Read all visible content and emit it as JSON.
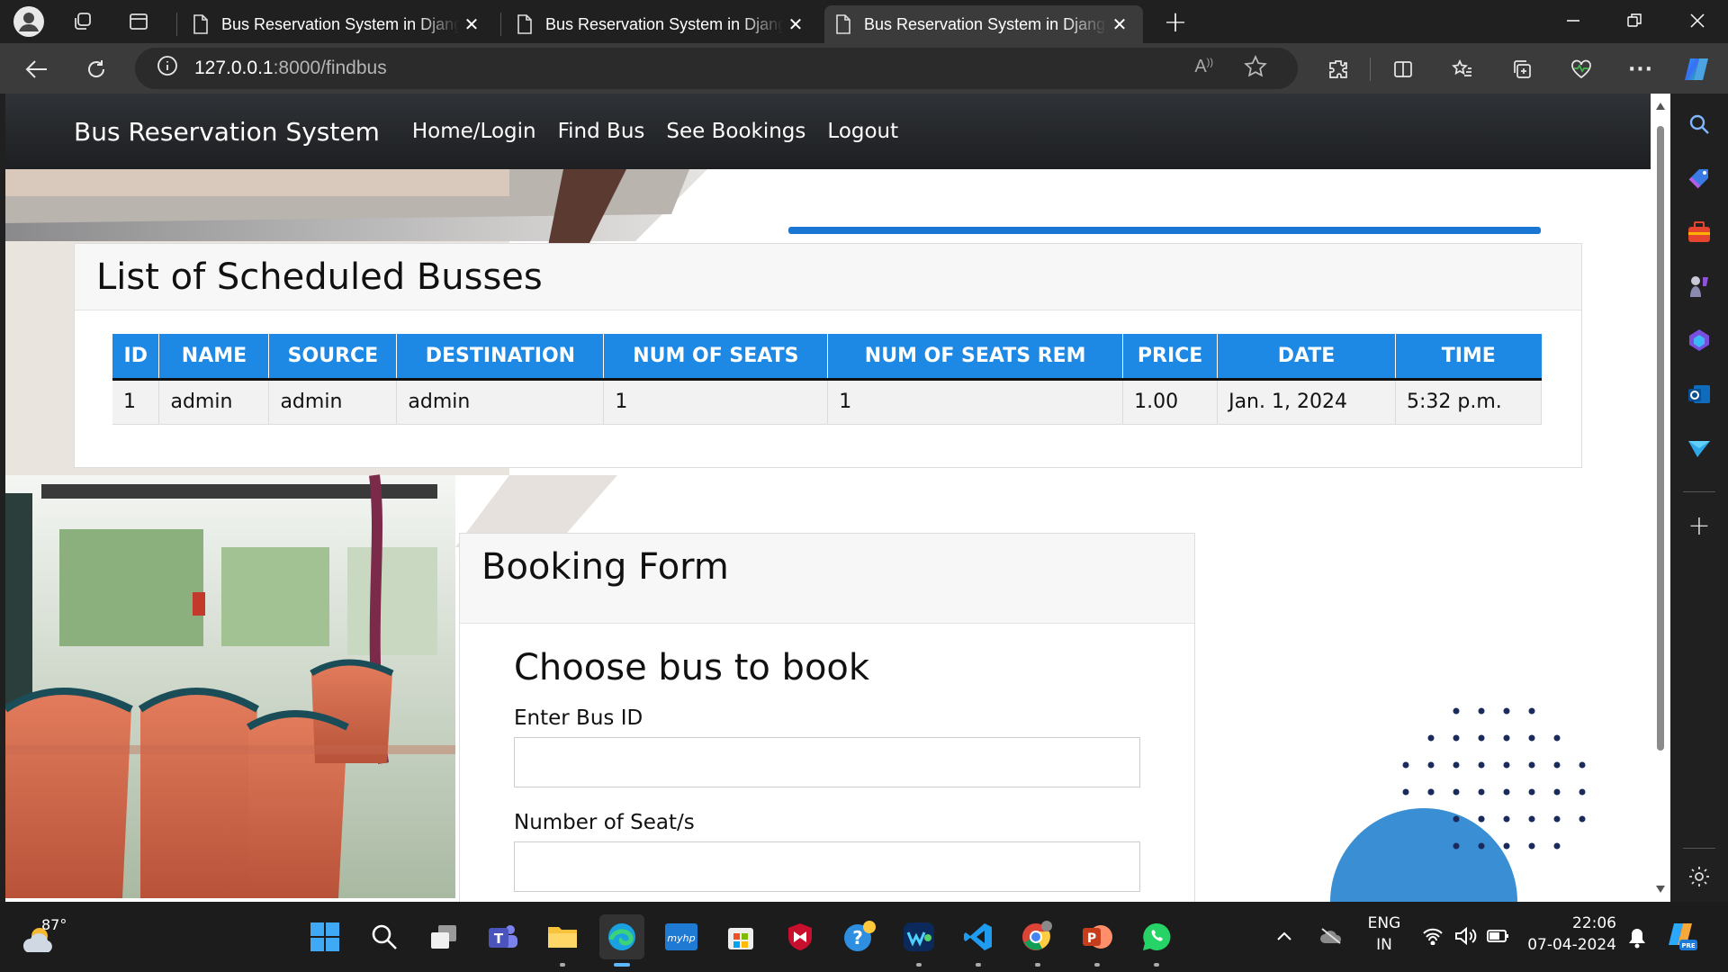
{
  "browser": {
    "tabs": [
      {
        "title": "Bus Reservation System in Django",
        "active": false
      },
      {
        "title": "Bus Reservation System in Django",
        "active": false
      },
      {
        "title": "Bus Reservation System in Django",
        "active": true
      }
    ],
    "url_host": "127.0.0.1",
    "url_path": ":8000/findbus"
  },
  "page": {
    "brand": "Bus Reservation System",
    "nav": [
      {
        "label": "Home/Login"
      },
      {
        "label": "Find Bus"
      },
      {
        "label": "See Bookings"
      },
      {
        "label": "Logout"
      }
    ],
    "bus_list": {
      "heading": "List of Scheduled Busses",
      "columns": [
        "ID",
        "NAME",
        "SOURCE",
        "DESTINATION",
        "NUM OF SEATS",
        "NUM OF SEATS REM",
        "PRICE",
        "DATE",
        "TIME"
      ],
      "rows": [
        [
          "1",
          "admin",
          "admin",
          "admin",
          "1",
          "1",
          "1.00",
          "Jan. 1, 2024",
          "5:32 p.m."
        ]
      ]
    },
    "booking": {
      "heading": "Booking Form",
      "subheading": "Choose bus to book",
      "bus_id_label": "Enter Bus ID",
      "bus_id_value": "",
      "seats_label": "Number of Seat/s",
      "seats_value": ""
    }
  },
  "taskbar": {
    "weather_temp": "87°",
    "lang_line1": "ENG",
    "lang_line2": "IN",
    "time": "22:06",
    "date": "07-04-2024"
  },
  "colors": {
    "table_header": "#1e88e5",
    "navbar": "#212529",
    "browser_frame": "#202020"
  }
}
